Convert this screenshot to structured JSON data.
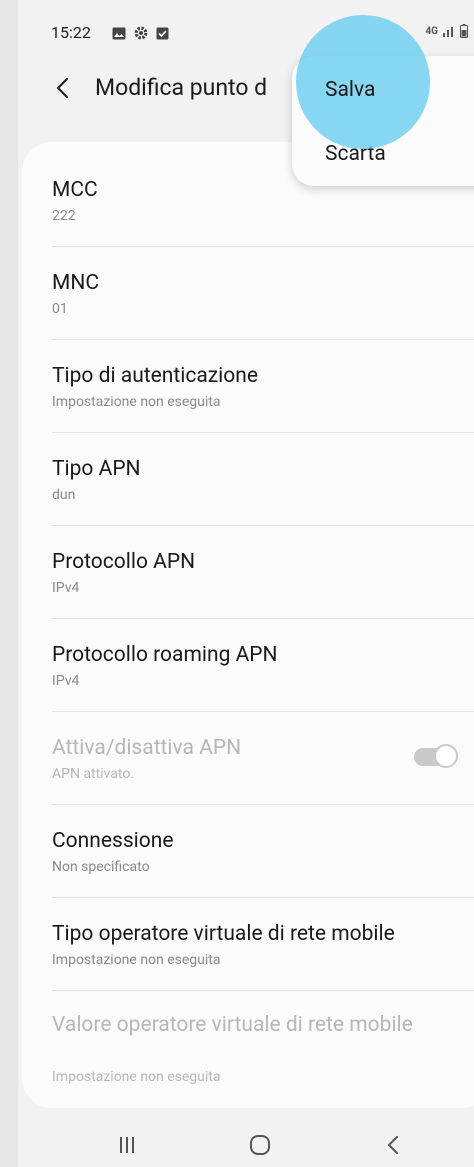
{
  "status": {
    "time": "15:22",
    "network": "4G"
  },
  "header": {
    "title": "Modifica punto d"
  },
  "menu": {
    "save": "Salva",
    "discard": "Scarta"
  },
  "rows": [
    {
      "title": "MCC",
      "sub": "222"
    },
    {
      "title": "MNC",
      "sub": "01"
    },
    {
      "title": "Tipo di autenticazione",
      "sub": "Impostazione non eseguita"
    },
    {
      "title": "Tipo APN",
      "sub": "dun"
    },
    {
      "title": "Protocollo APN",
      "sub": "IPv4"
    },
    {
      "title": "Protocollo roaming APN",
      "sub": "IPv4"
    },
    {
      "title": "Attiva/disattiva APN",
      "sub": "APN attivato."
    },
    {
      "title": "Connessione",
      "sub": "Non specificato"
    },
    {
      "title": "Tipo operatore virtuale di rete mobile",
      "sub": "Impostazione non eseguita"
    },
    {
      "title": "Valore operatore virtuale di rete mobile",
      "sub": "Impostazione non eseguita"
    }
  ],
  "colors": {
    "accent_touch": "#6ccef0",
    "background": "#f2f2f2",
    "card": "#fbfbfb"
  },
  "icons": [
    "image-icon",
    "gear-icon",
    "notification-icon",
    "signal-icon",
    "battery-icon",
    "back-arrow-icon",
    "recents-icon",
    "home-icon",
    "nav-back-icon"
  ]
}
